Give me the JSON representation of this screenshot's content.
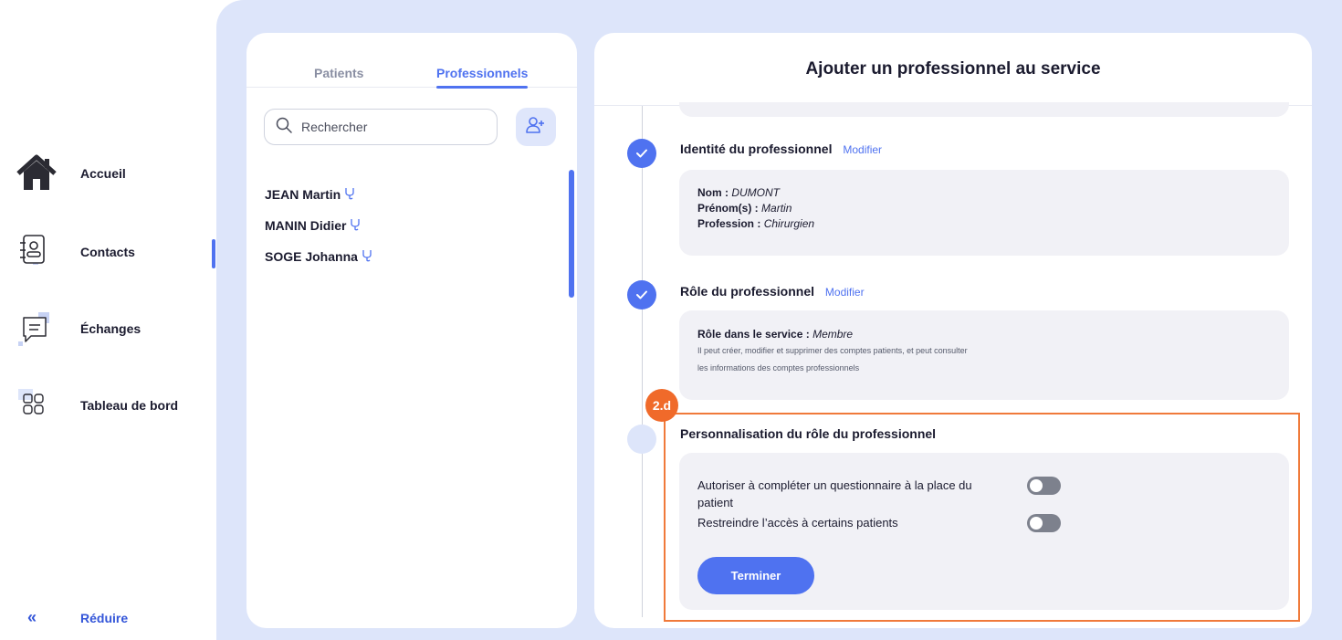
{
  "sidebar": {
    "items": [
      {
        "label": "Accueil",
        "icon": "home-icon"
      },
      {
        "label": "Contacts",
        "icon": "contacts-book-icon"
      },
      {
        "label": "Échanges",
        "icon": "chat-bubble-icon"
      },
      {
        "label": "Tableau de bord",
        "icon": "dashboard-grid-icon"
      }
    ],
    "active": "Contacts",
    "reduce_label": "Réduire",
    "reduce_icon": "double-chevron-left-icon"
  },
  "list": {
    "tabs": [
      {
        "label": "Patients",
        "active": false
      },
      {
        "label": "Professionnels",
        "active": true
      }
    ],
    "search_placeholder": "Rechercher",
    "add_icon": "add-user-icon",
    "contacts": [
      {
        "name": "JEAN Martin",
        "icon": "stethoscope-icon"
      },
      {
        "name": "MANIN Didier",
        "icon": "stethoscope-icon"
      },
      {
        "name": "SOGE Johanna",
        "icon": "stethoscope-icon"
      }
    ]
  },
  "form": {
    "title": "Ajouter un professionnel au service",
    "identity": {
      "title": "Identité du professionnel",
      "modify": "Modifier",
      "nom_label": "Nom :",
      "nom_value": "DUMONT",
      "prenom_label": "Prénom(s) :",
      "prenom_value": "Martin",
      "profession_label": "Profession :",
      "profession_value": "Chirurgien"
    },
    "role": {
      "title": "Rôle du professionnel",
      "modify": "Modifier",
      "role_label": "Rôle dans le service :",
      "role_value": "Membre",
      "desc_line1": "Il peut créer, modifier et supprimer des comptes patients, et peut consulter",
      "desc_line2": "les informations des comptes professionnels"
    },
    "custom": {
      "badge": "2.d",
      "title": "Personnalisation du rôle du professionnel",
      "toggle1_line1": "Autoriser à compléter un questionnaire à la place du",
      "toggle1_line2": "patient",
      "toggle1_on": false,
      "toggle2": "Restreindre l’accès à certains patients",
      "toggle2_on": false,
      "finish": "Terminer"
    }
  },
  "colors": {
    "accent": "#4f72f0",
    "highlight": "#f07a3a",
    "background": "#dde5fa"
  }
}
